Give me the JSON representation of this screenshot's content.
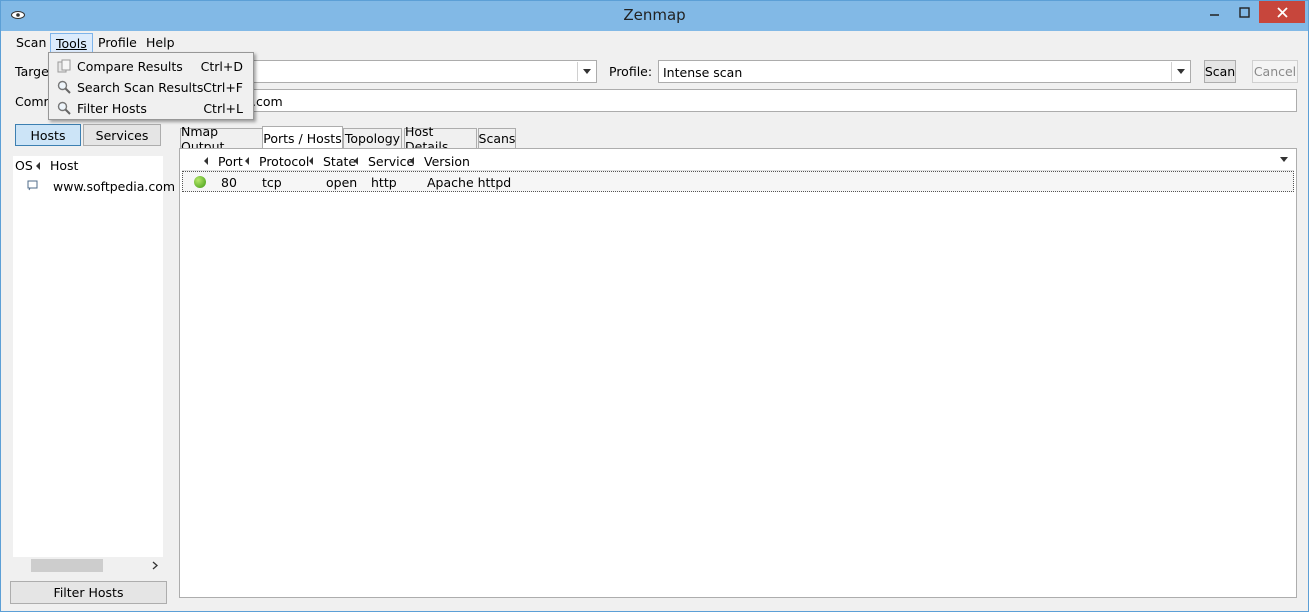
{
  "window": {
    "title": "Zenmap"
  },
  "menubar": {
    "items": [
      "Scan",
      "Tools",
      "Profile",
      "Help"
    ]
  },
  "tools_menu": {
    "items": [
      {
        "label": "Compare Results",
        "shortcut": "Ctrl+D",
        "icon": "compare-icon"
      },
      {
        "label": "Search Scan Results",
        "shortcut": "Ctrl+F",
        "icon": "search-icon"
      },
      {
        "label": "Filter Hosts",
        "shortcut": "Ctrl+L",
        "icon": "filter-icon"
      }
    ]
  },
  "toolbar": {
    "target_label": "Target",
    "target_value": "",
    "profile_label": "Profile:",
    "profile_value": "Intense scan",
    "scan_button": "Scan",
    "cancel_button": "Cancel",
    "command_label": "Comm",
    "command_value": ".com"
  },
  "sidebar": {
    "hosts_button": "Hosts",
    "services_button": "Services",
    "col_os": "OS",
    "col_host": "Host",
    "hosts": [
      {
        "name": "www.softpedia.com",
        "icon": "os-unknown-icon"
      }
    ],
    "filter_button": "Filter Hosts"
  },
  "tabs": [
    "Nmap Output",
    "Ports / Hosts",
    "Topology",
    "Host Details",
    "Scans"
  ],
  "selected_tab": "Ports / Hosts",
  "ports_table": {
    "columns": [
      "Port",
      "Protocol",
      "State",
      "Service",
      "Version"
    ],
    "rows": [
      {
        "status": "open",
        "port": "80",
        "protocol": "tcp",
        "state": "open",
        "service": "http",
        "version": "Apache httpd"
      }
    ]
  },
  "colors": {
    "title_bar": "#82b9e6",
    "close_button": "#c7463c",
    "status_open": "#3e9a14"
  }
}
